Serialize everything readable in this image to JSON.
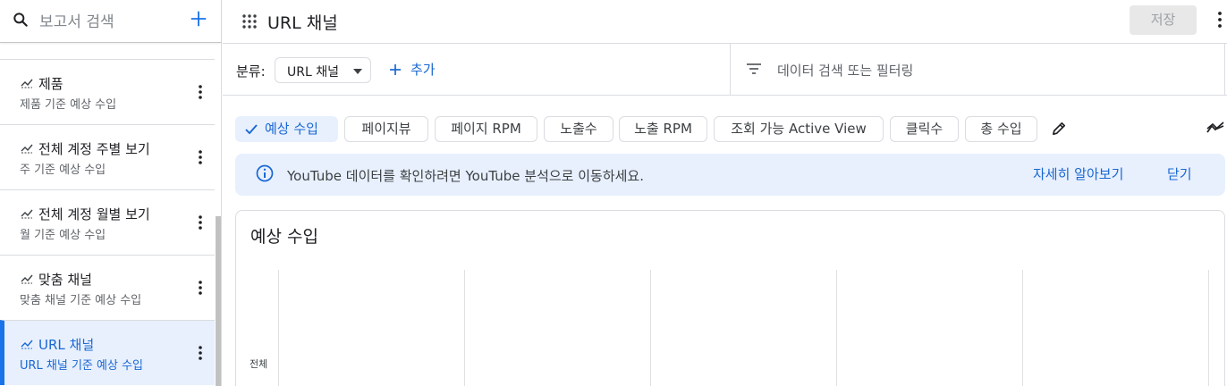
{
  "sidebar": {
    "search_placeholder": "보고서 검색",
    "items": [
      {
        "title": "제품",
        "subtitle": "제품 기준 예상 수입"
      },
      {
        "title": "전체 계정 주별 보기",
        "subtitle": "주 기준 예상 수입"
      },
      {
        "title": "전체 계정 월별 보기",
        "subtitle": "월 기준 예상 수입"
      },
      {
        "title": "맞춤 채널",
        "subtitle": "맞춤 채널 기준 예상 수입"
      },
      {
        "title": "URL 채널",
        "subtitle": "URL 채널 기준 예상 수입",
        "active": true
      }
    ]
  },
  "header": {
    "title": "URL 채널",
    "save_label": "저장"
  },
  "filterbar": {
    "group_label": "분류:",
    "group_value": "URL 채널",
    "add_label": "추가",
    "search_placeholder": "데이터 검색 또는 필터링"
  },
  "metrics": [
    {
      "label": "예상 수입",
      "selected": true
    },
    {
      "label": "페이지뷰",
      "selected": false
    },
    {
      "label": "페이지 RPM",
      "selected": false
    },
    {
      "label": "노출수",
      "selected": false
    },
    {
      "label": "노출 RPM",
      "selected": false
    },
    {
      "label": "조회 가능 Active View",
      "selected": false
    },
    {
      "label": "클릭수",
      "selected": false
    },
    {
      "label": "총 수입",
      "selected": false
    }
  ],
  "banner": {
    "message": "YouTube 데이터를 확인하려면 YouTube 분석으로 이동하세요.",
    "learn_more": "자세히 알아보기",
    "dismiss": "닫기"
  },
  "chart_card": {
    "title": "예상 수입",
    "row_label": "전체"
  },
  "colors": {
    "accent": "#1a73e8",
    "accent_text": "#1967d2",
    "selected_bg": "#e8f0fe"
  }
}
